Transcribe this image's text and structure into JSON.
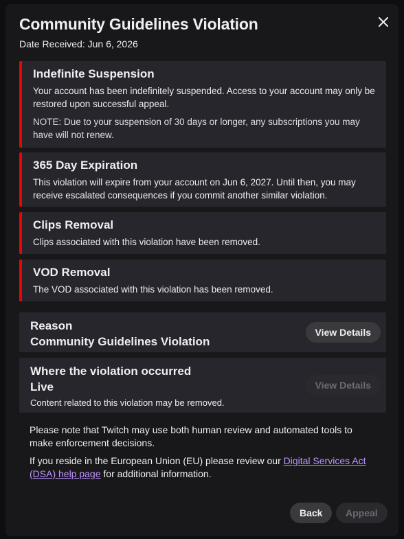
{
  "modal": {
    "title": "Community Guidelines Violation",
    "date_received": "Date Received: Jun 6, 2026",
    "close_icon": "close-icon"
  },
  "penalties": [
    {
      "title": "Indefinite Suspension",
      "text": "Your account has been indefinitely suspended. Access to your account may only be restored upon successful appeal.",
      "note": "NOTE: Due to your suspension of 30 days or longer, any subscriptions you may have will not renew."
    },
    {
      "title": "365 Day Expiration",
      "text": "This violation will expire from your account on Jun 6, 2027. Until then, you may receive escalated consequences if you commit another similar violation."
    },
    {
      "title": "Clips Removal",
      "text": "Clips associated with this violation have been removed."
    },
    {
      "title": "VOD Removal",
      "text": "The VOD associated with this violation has been removed."
    }
  ],
  "reason": {
    "label": "Reason",
    "value": "Community Guidelines Violation",
    "button": "View Details"
  },
  "location": {
    "label": "Where the violation occurred",
    "value": "Live",
    "sub": "Content related to this violation may be removed.",
    "button": "View Details"
  },
  "footer": {
    "note": "Please note that Twitch may use both human review and automated tools to make enforcement decisions.",
    "eu_prefix": "If you reside in the European Union (EU) please review our ",
    "eu_link": "Digital Services Act (DSA) help page",
    "eu_suffix": " for additional information."
  },
  "actions": {
    "back": "Back",
    "appeal": "Appeal"
  },
  "colors": {
    "alert_border": "#eb0400",
    "link": "#bf94ff",
    "modal_bg": "#18181b",
    "card_bg": "#26262c"
  }
}
